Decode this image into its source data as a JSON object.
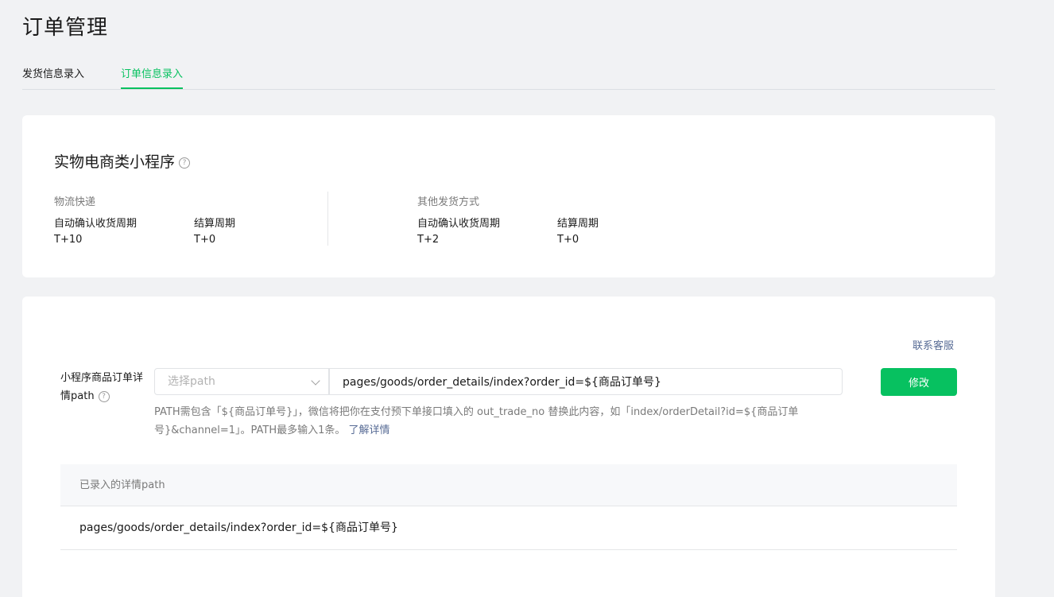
{
  "page": {
    "title": "订单管理"
  },
  "tabs": [
    {
      "label": "发货信息录入",
      "active": false
    },
    {
      "label": "订单信息录入",
      "active": true
    }
  ],
  "summary": {
    "title": "实物电商类小程序",
    "help_glyph": "?",
    "groups": [
      {
        "label": "物流快递",
        "items": [
          {
            "label": "自动确认收货周期",
            "value": "T+10"
          },
          {
            "label": "结算周期",
            "value": "T+0"
          }
        ]
      },
      {
        "label": "其他发货方式",
        "items": [
          {
            "label": "自动确认收货周期",
            "value": "T+2"
          },
          {
            "label": "结算周期",
            "value": "T+0"
          }
        ]
      }
    ]
  },
  "path_config": {
    "contact_link": "联系客服",
    "label": "小程序商品订单详情path",
    "help_glyph": "?",
    "select_placeholder": "选择path",
    "input_value": "pages/goods/order_details/index?order_id=${商品订单号}",
    "button_label": "修改",
    "hint_text": "PATH需包含「${商品订单号}」，微信将把你在支付预下单接口填入的 out_trade_no 替换此内容，如「index/orderDetail?id=${商品订单号}&channel=1」。PATH最多输入1条。",
    "hint_link": "了解详情"
  },
  "table": {
    "header": "已录入的详情path",
    "rows": [
      "pages/goods/order_details/index?order_id=${商品订单号}"
    ]
  },
  "colors": {
    "accent": "#07c160",
    "link": "#576b95",
    "background": "#f1f2f4"
  }
}
